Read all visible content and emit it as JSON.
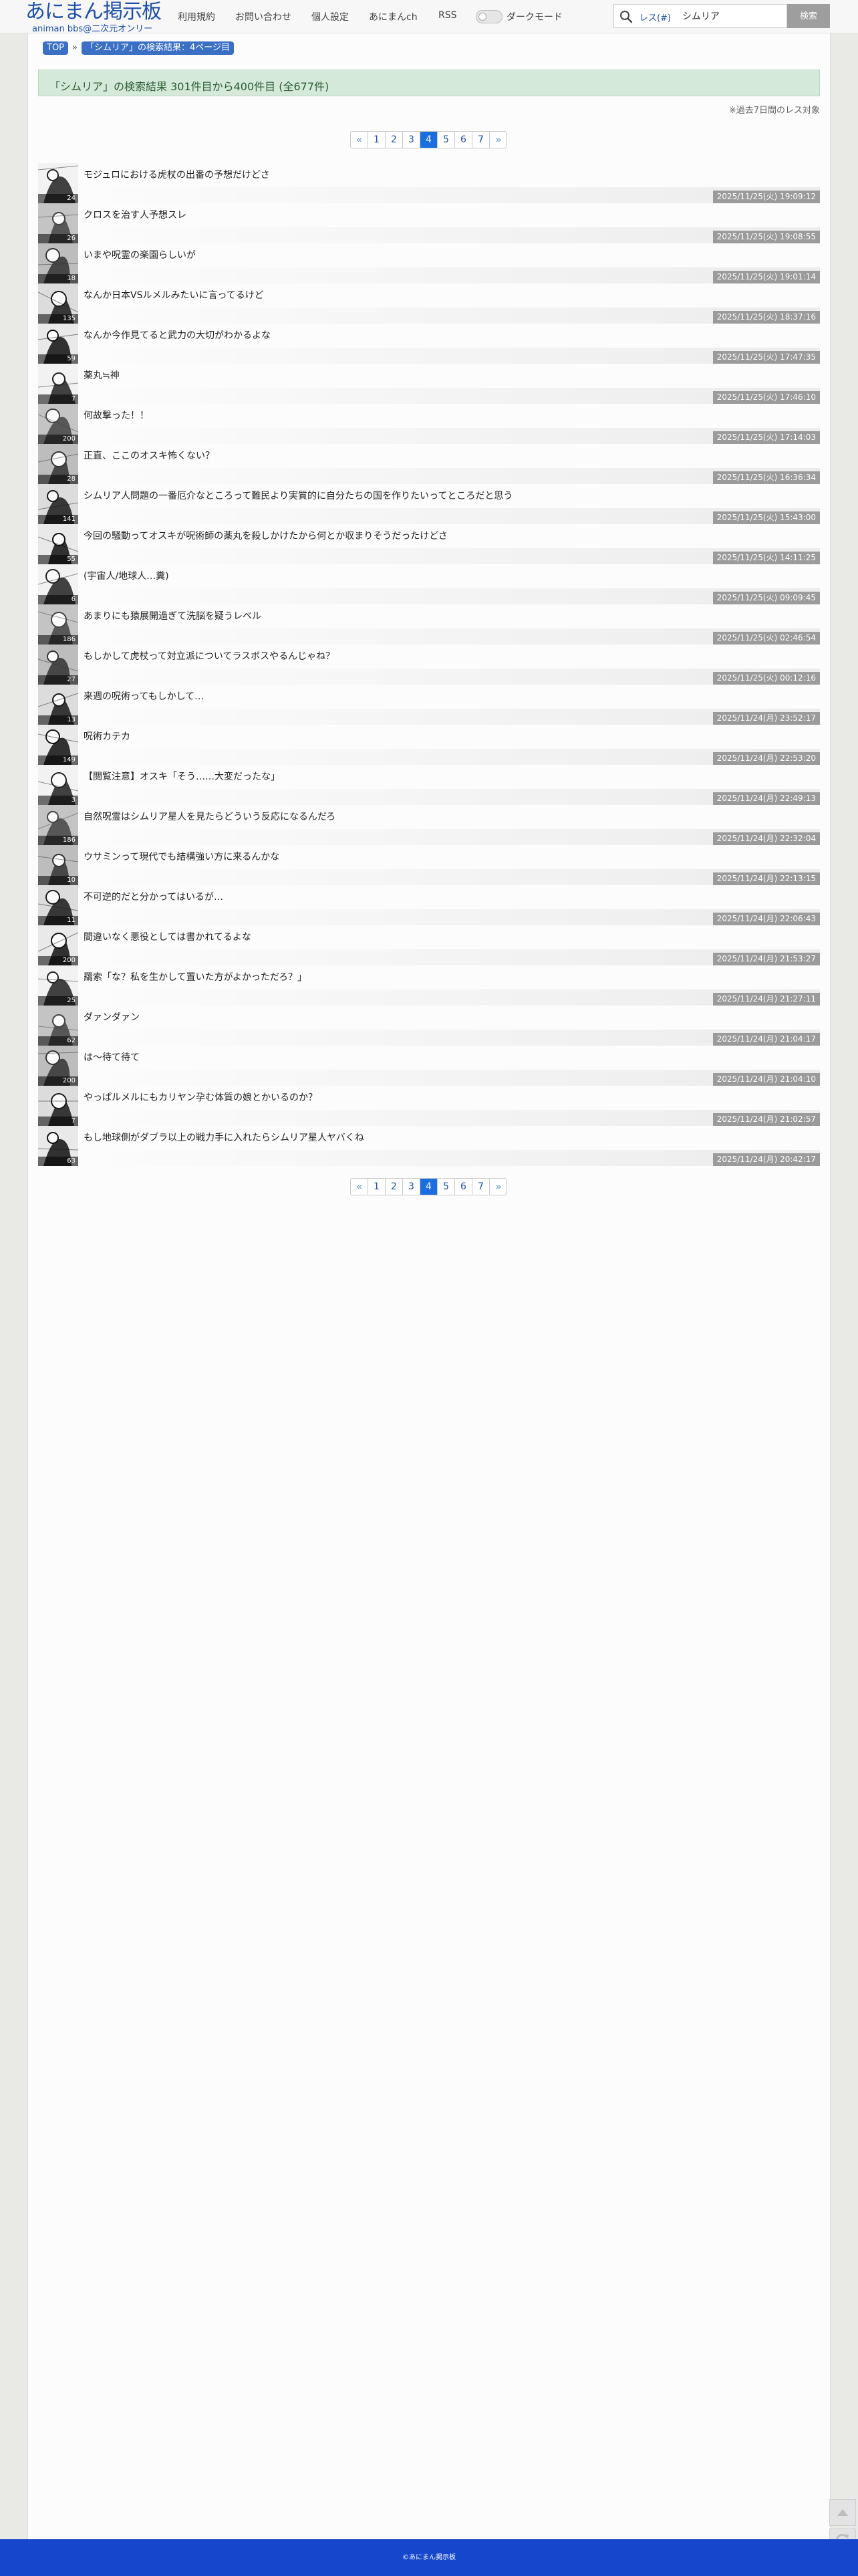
{
  "header": {
    "logo_main": "あにまん掲示板",
    "logo_sub": "animan bbs@二次元オンリー",
    "nav": [
      "利用規約",
      "お問い合わせ",
      "個人設定",
      "あにまんch",
      "RSS"
    ],
    "dark_mode_label": "ダークモード",
    "dark_mode_on": false,
    "search_scope": "レス(#)",
    "search_value": "シムリア",
    "search_button": "検索"
  },
  "breadcrumb": {
    "top": "TOP",
    "current": "「シムリア」の検索結果：4ページ目"
  },
  "result_summary": "「シムリア」の検索結果 301件目から400件目 (全677件)",
  "note": "※過去7日間のレス対象",
  "pagination": {
    "prev": "«",
    "next": "»",
    "pages": [
      "1",
      "2",
      "3",
      "4",
      "5",
      "6",
      "7"
    ],
    "current": "4"
  },
  "threads": [
    {
      "title": "モジュロにおける虎杖の出番の予想だけどさ",
      "count": "24",
      "date": "2025/11/25(火) 19:09:12"
    },
    {
      "title": "クロスを治す人予想スレ",
      "count": "26",
      "date": "2025/11/25(火) 19:08:55"
    },
    {
      "title": "いまや呪霊の楽園らしいが",
      "count": "18",
      "date": "2025/11/25(火) 19:01:14"
    },
    {
      "title": "なんか日本VSルメルみたいに言ってるけど",
      "count": "135",
      "date": "2025/11/25(火) 18:37:16"
    },
    {
      "title": "なんか今作見てると武力の大切がわかるよな",
      "count": "59",
      "date": "2025/11/25(火) 17:47:35"
    },
    {
      "title": "薬丸≒神",
      "count": "7",
      "date": "2025/11/25(火) 17:46:10"
    },
    {
      "title": "何故撃った！！",
      "count": "200",
      "date": "2025/11/25(火) 17:14:03"
    },
    {
      "title": "正直、ここのオスキ怖くない？",
      "count": "28",
      "date": "2025/11/25(火) 16:36:34"
    },
    {
      "title": "シムリア人問題の一番厄介なところって難民より実質的に自分たちの国を作りたいってところだと思う",
      "count": "141",
      "date": "2025/11/25(火) 15:43:00"
    },
    {
      "title": "今回の騒動ってオスキが呪術師の薬丸を殺しかけたから何とか収まりそうだったけどさ",
      "count": "55",
      "date": "2025/11/25(火) 14:11:25"
    },
    {
      "title": "(宇宙人/地球人…糞)",
      "count": "6",
      "date": "2025/11/25(火) 09:09:45"
    },
    {
      "title": "あまりにも猿展開過ぎて洗脳を疑うレベル",
      "count": "186",
      "date": "2025/11/25(火) 02:46:54"
    },
    {
      "title": "もしかして虎杖って対立派についてラスボスやるんじゃね？",
      "count": "27",
      "date": "2025/11/25(火) 00:12:16"
    },
    {
      "title": "来週の呪術ってもしかして…",
      "count": "13",
      "date": "2025/11/24(月) 23:52:17"
    },
    {
      "title": "呪術カテカ",
      "count": "149",
      "date": "2025/11/24(月) 22:53:20"
    },
    {
      "title": "【閲覧注意】オスキ「そう……大変だったな」",
      "count": "3",
      "date": "2025/11/24(月) 22:49:13"
    },
    {
      "title": "自然呪霊はシムリア星人を見たらどういう反応になるんだろ",
      "count": "186",
      "date": "2025/11/24(月) 22:32:04"
    },
    {
      "title": "ウサミンって現代でも結構強い方に来るんかな",
      "count": "10",
      "date": "2025/11/24(月) 22:13:15"
    },
    {
      "title": "不可逆的だと分かってはいるが…",
      "count": "11",
      "date": "2025/11/24(月) 22:06:43"
    },
    {
      "title": "間違いなく悪役としては書かれてるよな",
      "count": "200",
      "date": "2025/11/24(月) 21:53:27"
    },
    {
      "title": "羂索「な？私を生かして置いた方がよかっただろ？」",
      "count": "25",
      "date": "2025/11/24(月) 21:27:11"
    },
    {
      "title": "ダァンダァン",
      "count": "62",
      "date": "2025/11/24(月) 21:04:17"
    },
    {
      "title": "は～待て待て",
      "count": "200",
      "date": "2025/11/24(月) 21:04:10"
    },
    {
      "title": "やっぱルメルにもカリヤン孕む体質の娘とかいるのか？",
      "count": "7",
      "date": "2025/11/24(月) 21:02:57"
    },
    {
      "title": "もし地球側がダブラ以上の戦力手に入れたらシムリア星人ヤバくね",
      "count": "63",
      "date": "2025/11/24(月) 20:42:17"
    }
  ],
  "footer": "©あにまん掲示板",
  "colors": {
    "accent": "#1a6ee0",
    "footer": "#1546cc",
    "banner": "#d4e9d9",
    "logo": "#1e4fa8"
  }
}
